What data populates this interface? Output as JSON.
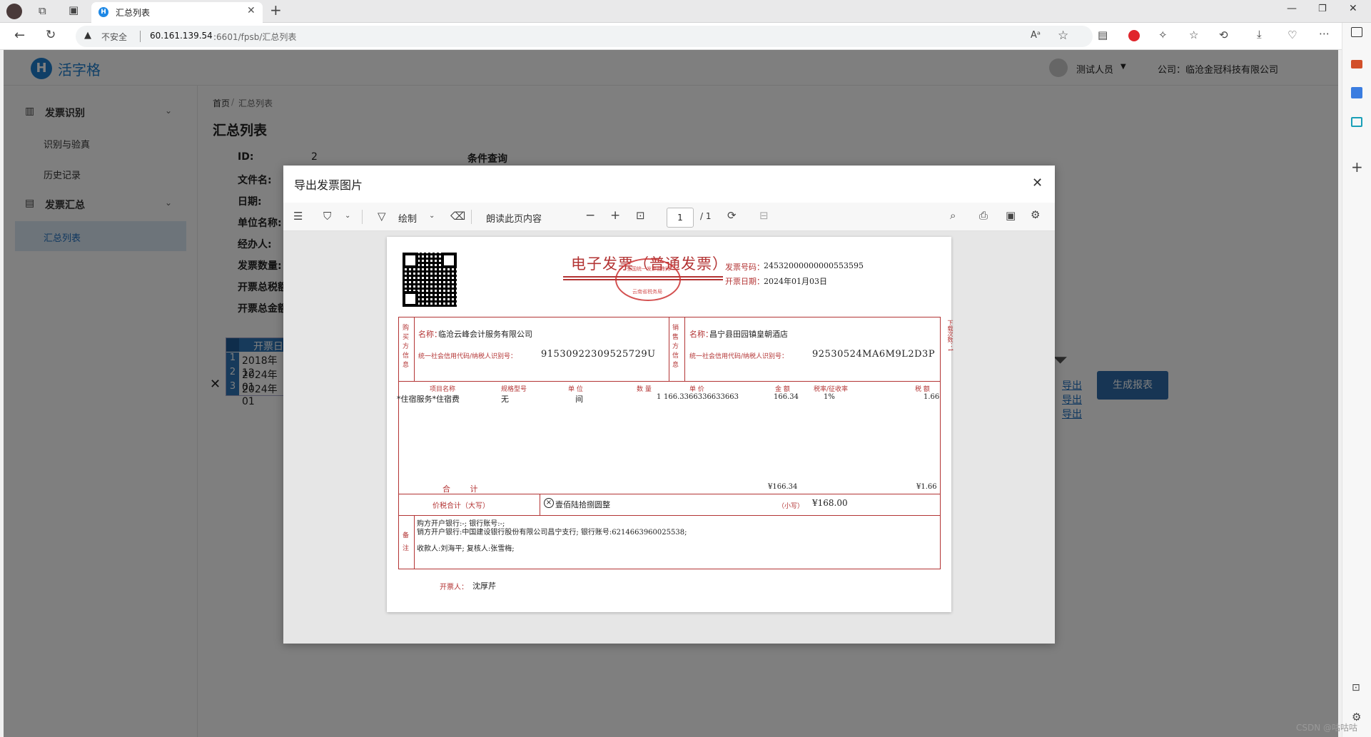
{
  "browser": {
    "tab_title": "汇总列表",
    "insecure_label": "不安全",
    "url_host": "60.161.139.54",
    "url_rest": ":6601/fpsb/汇总列表"
  },
  "app": {
    "logo_text": "活字格",
    "user_name": "测试人员",
    "company": "公司：临沧金冠科技有限公司"
  },
  "sidebar": {
    "group1": "发票识别",
    "group1_items": [
      "识别与验真",
      "历史记录"
    ],
    "group2": "发票汇总",
    "group2_items": [
      "汇总列表"
    ]
  },
  "content": {
    "breadcrumb_home": "首页",
    "breadcrumb_sep": "/",
    "breadcrumb_current": "汇总列表",
    "page_title": "汇总列表",
    "fields": [
      "ID:",
      "文件名:",
      "日期:",
      "单位名称:",
      "经办人:",
      "发票数量:",
      "开票总税额",
      "开票总金额"
    ],
    "id_value": "2",
    "query_label": "条件查询",
    "generate_button": "生成报表",
    "table_header": "开票日",
    "rows": [
      {
        "n": "1",
        "d": "2018年12"
      },
      {
        "n": "2",
        "d": "2024年01"
      },
      {
        "n": "3",
        "d": "2024年01"
      }
    ],
    "export_label": "导出"
  },
  "dialog": {
    "title": "导出发票图片",
    "toolbar": {
      "draw": "绘制",
      "read_aloud": "朗读此页内容",
      "page_num": "1",
      "page_total": "/ 1"
    }
  },
  "invoice": {
    "title": "电子发票（普通发票）",
    "number_label": "发票号码：",
    "number": "24532000000000553595",
    "date_label": "开票日期：",
    "date": "2024年01月03日",
    "buyer_side": [
      "购",
      "买",
      "方",
      "信",
      "息"
    ],
    "seller_side": [
      "销",
      "售",
      "方",
      "信",
      "息"
    ],
    "buyer_name_label": "名称：",
    "buyer_name": "临沧云峰会计服务有限公司",
    "buyer_code_label": "统一社会信用代码/纳税人识别号：",
    "buyer_code": "91530922309525729U",
    "seller_name_label": "名称：",
    "seller_name": "昌宁县田园镇皇朝酒店",
    "seller_code_label": "统一社会信用代码/纳税人识别号：",
    "seller_code": "92530524MA6M9L2D3P",
    "columns": [
      "项目名称",
      "规格型号",
      "单 位",
      "数 量",
      "单 价",
      "金 额",
      "税率/征收率",
      "税 额"
    ],
    "item": {
      "name": "*住宿服务*住宿费",
      "spec": "无",
      "unit": "间",
      "qty": "1",
      "price": "166.3366336633663",
      "amount": "166.34",
      "rate": "1%",
      "tax": "1.66"
    },
    "total_label": "合 计",
    "total_amount": "¥166.34",
    "total_tax": "¥1.66",
    "grand_label": "价税合计（大写）",
    "grand_words": "壹佰陆拾捌圆整",
    "grand_small_label": "（小写）",
    "grand_small": "¥168.00",
    "remark_side": [
      "备",
      "注"
    ],
    "remark_lines": [
      "购方开户银行:-;      银行账号:-;",
      "销方开户银行:中国建设银行股份有限公司昌宁支行;      银行账号:6214663960025538;",
      "收款人:刘海平;      复核人:张雪梅;"
    ],
    "issuer_label": "开票人：",
    "issuer": "沈厚芹",
    "download_note": "下载次数：1",
    "seal_top": "全国统一发票监制章",
    "seal_bottom": "云南省税务局"
  },
  "watermark": "CSDN @咕咕咕"
}
